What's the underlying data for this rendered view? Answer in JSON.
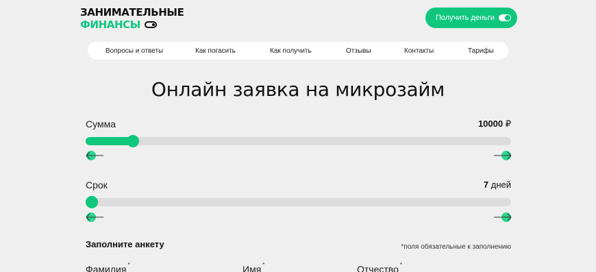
{
  "header": {
    "logo_line1": "ЗАНИМАТЕЛЬНЫЕ",
    "logo_line2": "ФИНАНСЫ",
    "cta_label": "Получить деньги"
  },
  "nav": {
    "items": [
      "Вопросы и ответы",
      "Как погасить",
      "Как получить",
      "Отзывы",
      "Контакты",
      "Тарифы"
    ]
  },
  "page": {
    "title": "Онлайн заявка на микрозайм"
  },
  "calculator": {
    "amount": {
      "label": "Сумма",
      "value": "10000",
      "unit": "₽",
      "fraction": 0.1
    },
    "term": {
      "label": "Срок",
      "value": "7",
      "unit": "дней",
      "fraction": 0.0
    }
  },
  "form": {
    "title": "Заполните анкету",
    "required_note": "*поля обязательные к заполнению",
    "fields": [
      {
        "label": "Фамилия",
        "mark": "*"
      },
      {
        "label": "Имя",
        "mark": "*"
      },
      {
        "label": "Отчество",
        "mark": "*"
      }
    ]
  },
  "colors": {
    "accent": "#10c77d",
    "background": "#efefef",
    "track": "#dcdcdc"
  }
}
